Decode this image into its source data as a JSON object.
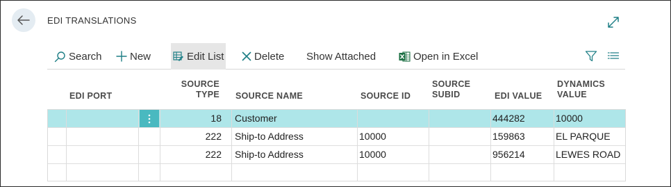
{
  "page": {
    "title": "EDI TRANSLATIONS"
  },
  "actions": {
    "search": "Search",
    "new": "New",
    "edit_list": "Edit List",
    "delete": "Delete",
    "show_attached": "Show Attached",
    "open_in_excel": "Open in Excel"
  },
  "columns": {
    "edi_port": "EDI PORT",
    "source_type_1": "SOURCE",
    "source_type_2": "TYPE",
    "source_name": "SOURCE NAME",
    "source_id": "SOURCE ID",
    "source_subid_1": "SOURCE",
    "source_subid_2": "SUBID",
    "edi_value": "EDI VALUE",
    "dynamics_value_1": "DYNAMICS",
    "dynamics_value_2": "VALUE"
  },
  "rows": [
    {
      "edi_port": "",
      "source_type": "18",
      "source_name": "Customer",
      "source_id": "",
      "source_subid": "",
      "edi_value": "444282",
      "dynamics_value": "10000"
    },
    {
      "edi_port": "",
      "source_type": "222",
      "source_name": "Ship-to Address",
      "source_id": "10000",
      "source_subid": "",
      "edi_value": "159863",
      "dynamics_value": "EL PARQUE"
    },
    {
      "edi_port": "",
      "source_type": "222",
      "source_name": "Ship-to Address",
      "source_id": "10000",
      "source_subid": "",
      "edi_value": "956214",
      "dynamics_value": "LEWES ROAD"
    }
  ],
  "icons": {
    "back": "back-arrow-icon",
    "expand": "expand-icon",
    "search": "search-icon",
    "new": "plus-icon",
    "edit_list": "edit-list-icon",
    "delete": "delete-x-icon",
    "excel": "excel-icon",
    "filter": "filter-icon",
    "list_view": "list-view-icon",
    "row_menu": "row-menu-dots-icon"
  },
  "colors": {
    "accent": "#1f7f86",
    "selected_row": "#aee6e9",
    "row_menu": "#49b9c0",
    "excel_green": "#1d7044"
  }
}
